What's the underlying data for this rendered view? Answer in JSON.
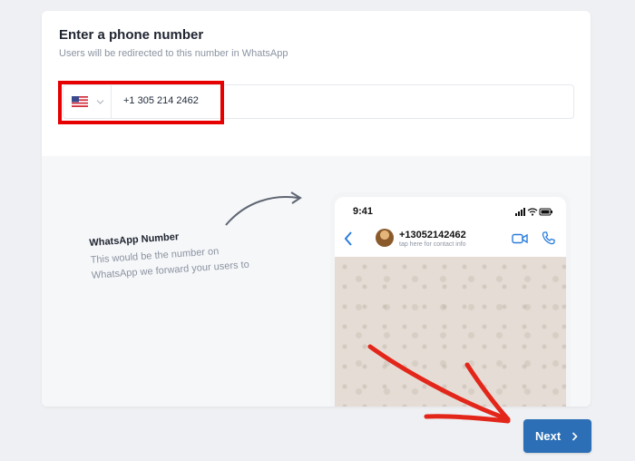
{
  "form": {
    "title": "Enter a phone number",
    "subtitle": "Users will be redirected to this number in WhatsApp",
    "country_flag": "us-flag-icon",
    "phone_value": "+1 305 214 2462"
  },
  "preview": {
    "note_heading": "WhatsApp Number",
    "note_line1": "This would be the number on",
    "note_line2": "WhatsApp we forward your users to",
    "status_time": "9:41",
    "contact_name": "+13052142462",
    "contact_sub": "tap here for contact info"
  },
  "footer": {
    "next_label": "Next"
  },
  "colors": {
    "accent": "#2c6fb6",
    "highlight": "#e60000",
    "whatsapp_blue": "#2b7ddc",
    "wallpaper": "#e5ddd5"
  }
}
